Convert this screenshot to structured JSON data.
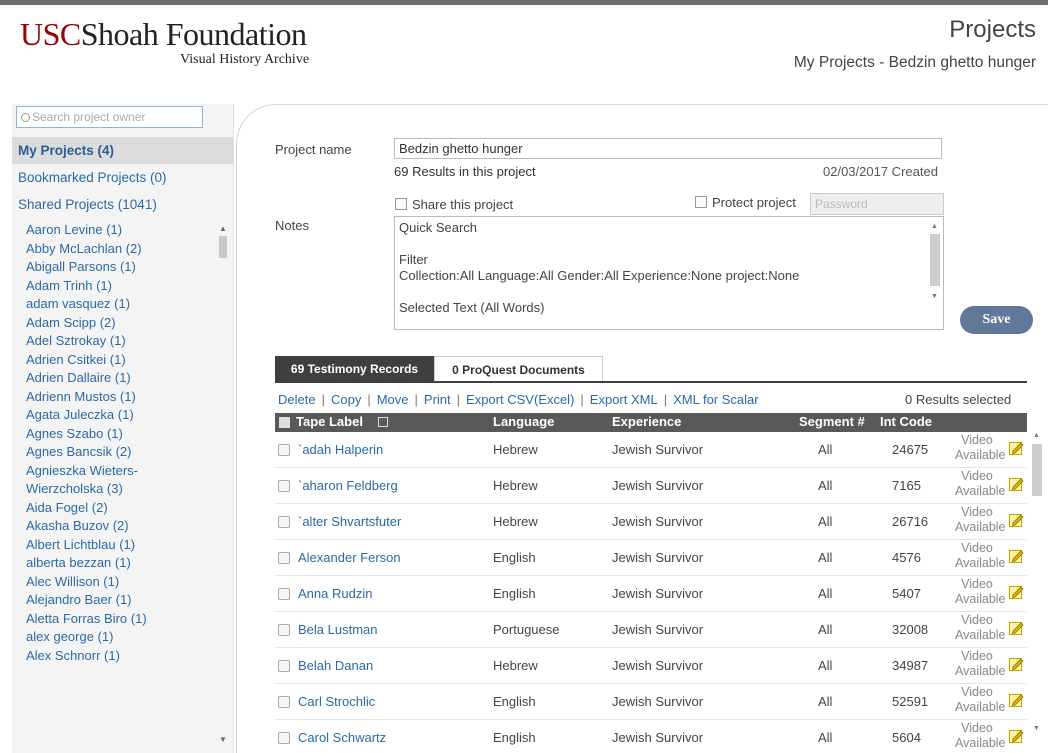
{
  "header": {
    "logo_usc": "USC",
    "logo_rest": "Shoah Foundation",
    "logo_sub": "Visual History Archive",
    "title": "Projects",
    "subtitle": "My Projects - Bedzin ghetto hunger"
  },
  "sidebar": {
    "search_placeholder": "Search project owner",
    "nav": [
      {
        "label": "My Projects (4)"
      },
      {
        "label": "Bookmarked Projects (0)"
      },
      {
        "label": "Shared Projects (1041)"
      }
    ],
    "owners": [
      "Aaron Levine (1)",
      "Abby McLachlan (2)",
      "Abigall Parsons (1)",
      "Adam Trinh (1)",
      "adam vasquez (1)",
      "Adam Scipp (2)",
      "Adel Sztrokay (1)",
      "Adrien Csitkei (1)",
      "Adrien Dallaire (1)",
      "Adrienn Mustos (1)",
      "Agata Juleczka (1)",
      "Agnes Szabo (1)",
      "Agnes Bancsik (2)",
      "Agnieszka Wieters-Wierzcholska (3)",
      "Aida Fogel (2)",
      "Akasha Buzov (2)",
      "Albert Lichtblau (1)",
      "alberta bezzan (1)",
      "Alec Willison (1)",
      "Alejandro Baer (1)",
      "Aletta Forras Biro (1)",
      "alex george (1)",
      "Alex Schnorr (1)"
    ]
  },
  "project": {
    "name_label": "Project name",
    "name_value": "Bedzin ghetto hunger",
    "results": "69 Results in this project",
    "created": "02/03/2017 Created",
    "share_label": "Share this project",
    "protect_label": "Protect project",
    "password_placeholder": "Password",
    "notes_label": "Notes",
    "notes_lines": [
      "Quick Search",
      "",
      "Filter",
      "Collection:All Language:All Gender:All Experience:None project:None",
      "",
      "Selected Text (All Words)"
    ],
    "save_label": "Save"
  },
  "tabs": [
    {
      "label": "69 Testimony Records"
    },
    {
      "label": "0 ProQuest Documents"
    }
  ],
  "actions": [
    "Delete",
    "Copy",
    "Move",
    "Print",
    "Export CSV(Excel)",
    "Export XML",
    "XML for Scalar"
  ],
  "selected_count": "0 Results selected",
  "table": {
    "columns": [
      "Tape Label",
      "Language",
      "Experience",
      "Segment #",
      "Int Code"
    ],
    "video_label": "Video Available",
    "rows": [
      {
        "name": "`adah Halperin",
        "language": "Hebrew",
        "experience": "Jewish Survivor",
        "segment": "All",
        "code": "24675"
      },
      {
        "name": "`aharon Feldberg",
        "language": "Hebrew",
        "experience": "Jewish Survivor",
        "segment": "All",
        "code": "7165"
      },
      {
        "name": "`alter Shvartsfuter",
        "language": "Hebrew",
        "experience": "Jewish Survivor",
        "segment": "All",
        "code": "26716"
      },
      {
        "name": "Alexander Ferson",
        "language": "English",
        "experience": "Jewish Survivor",
        "segment": "All",
        "code": "4576"
      },
      {
        "name": "Anna Rudzin",
        "language": "English",
        "experience": "Jewish Survivor",
        "segment": "All",
        "code": "5407"
      },
      {
        "name": "Bela Lustman",
        "language": "Portuguese",
        "experience": "Jewish Survivor",
        "segment": "All",
        "code": "32008"
      },
      {
        "name": "Belah Danan",
        "language": "Hebrew",
        "experience": "Jewish Survivor",
        "segment": "All",
        "code": "34987"
      },
      {
        "name": "Carl Strochlic",
        "language": "English",
        "experience": "Jewish Survivor",
        "segment": "All",
        "code": "52591"
      },
      {
        "name": "Carol Schwartz",
        "language": "English",
        "experience": "Jewish Survivor",
        "segment": "All",
        "code": "5604"
      }
    ]
  }
}
